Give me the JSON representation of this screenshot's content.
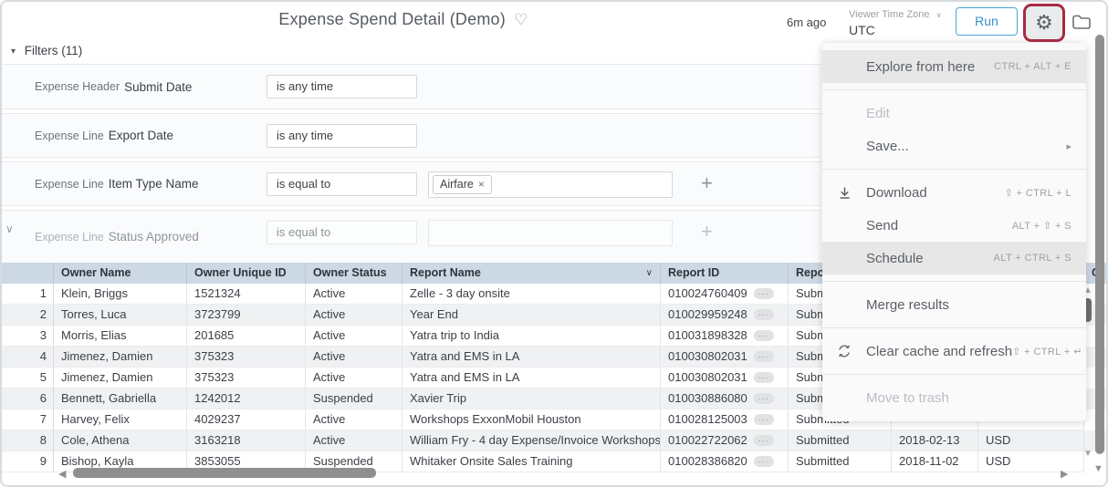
{
  "header": {
    "title": "Expense Spend Detail (Demo)",
    "last_run": "6m ago",
    "timezone_label": "Viewer Time Zone",
    "timezone_value": "UTC",
    "run_label": "Run"
  },
  "filters": {
    "title": "Filters (11)",
    "rows": [
      {
        "view": "Expense Header",
        "field": "Submit Date",
        "operator": "is any time",
        "value_chip": ""
      },
      {
        "view": "Expense Line",
        "field": "Export Date",
        "operator": "is any time",
        "value_chip": ""
      },
      {
        "view": "Expense Line",
        "field": "Item Type Name",
        "operator": "is equal to",
        "value_chip": "Airfare"
      },
      {
        "view": "Expense Line",
        "field": "Status Approved",
        "operator": "is equal to",
        "value_chip": ""
      }
    ]
  },
  "table": {
    "columns": [
      "",
      "Owner Name",
      "Owner Unique ID",
      "Owner Status",
      "Report Name",
      "Report ID",
      "Report Status",
      "",
      "",
      "C"
    ],
    "sort_column": "Report Name",
    "rows": [
      [
        "1",
        "Klein, Briggs",
        "1521324",
        "Active",
        "Zelle - 3 day onsite",
        "010024760409",
        "Submitted",
        "",
        ""
      ],
      [
        "2",
        "Torres, Luca",
        "3723799",
        "Active",
        "Year End",
        "010029959248",
        "Submitted",
        "",
        ""
      ],
      [
        "3",
        "Morris, Elias",
        "201685",
        "Active",
        "Yatra trip to India",
        "010031898328",
        "Submitted",
        "",
        ""
      ],
      [
        "4",
        "Jimenez, Damien",
        "375323",
        "Active",
        "Yatra and EMS in LA",
        "010030802031",
        "Submitted",
        "",
        ""
      ],
      [
        "5",
        "Jimenez, Damien",
        "375323",
        "Active",
        "Yatra and EMS in LA",
        "010030802031",
        "Submitted",
        "",
        ""
      ],
      [
        "6",
        "Bennett, Gabriella",
        "1242012",
        "Suspended",
        "Xavier Trip",
        "010030886080",
        "Submitted",
        "",
        ""
      ],
      [
        "7",
        "Harvey, Felix",
        "4029237",
        "Active",
        "Workshops ExxonMobil Houston",
        "010028125003",
        "Submitted",
        "",
        ""
      ],
      [
        "8",
        "Cole, Athena",
        "3163218",
        "Active",
        "William Fry - 4 day Expense/Invoice Workshops",
        "010022722062",
        "Submitted",
        "2018-02-13",
        "USD"
      ],
      [
        "9",
        "Bishop, Kayla",
        "3853055",
        "Suspended",
        "Whitaker Onsite Sales Training",
        "010028386820",
        "Submitted",
        "2018-11-02",
        "USD"
      ]
    ]
  },
  "menu": {
    "items": [
      {
        "type": "item",
        "label": "Explore from here",
        "shortcut": "CTRL + ALT + E",
        "state": "highlighted"
      },
      {
        "type": "divider"
      },
      {
        "type": "item",
        "label": "Edit",
        "state": "disabled"
      },
      {
        "type": "item",
        "label": "Save...",
        "submenu": true
      },
      {
        "type": "divider"
      },
      {
        "type": "item",
        "label": "Download",
        "shortcut": "⇧ + CTRL + L",
        "icon": "download-icon"
      },
      {
        "type": "item",
        "label": "Send",
        "shortcut": "ALT + ⇧ + S"
      },
      {
        "type": "item",
        "label": "Schedule",
        "shortcut": "ALT + CTRL + S",
        "state": "highlighted"
      },
      {
        "type": "divider"
      },
      {
        "type": "item",
        "label": "Merge results"
      },
      {
        "type": "divider"
      },
      {
        "type": "item",
        "label": "Clear cache and refresh",
        "shortcut": "⇧ + CTRL + ↵",
        "icon": "refresh-icon"
      },
      {
        "type": "divider"
      },
      {
        "type": "item",
        "label": "Move to trash",
        "state": "disabled"
      }
    ]
  },
  "icons": {
    "heart": "♡",
    "gear": "⚙",
    "triangle_down": "▾",
    "chevron_down": "∨",
    "plus": "+",
    "close": "×",
    "ellipsis": "···",
    "submenu_arrow": "▸",
    "arrow_up": "▲",
    "arrow_down": "▼",
    "arrow_left": "◀",
    "arrow_right": "▶"
  },
  "colors": {
    "accent_blue": "#3a9fd6",
    "annotation_red": "#a72b45",
    "table_header_bg": "#ccd8e3",
    "row_alt_bg": "#f0f1f2",
    "menu_highlight": "#e7e7e7"
  }
}
